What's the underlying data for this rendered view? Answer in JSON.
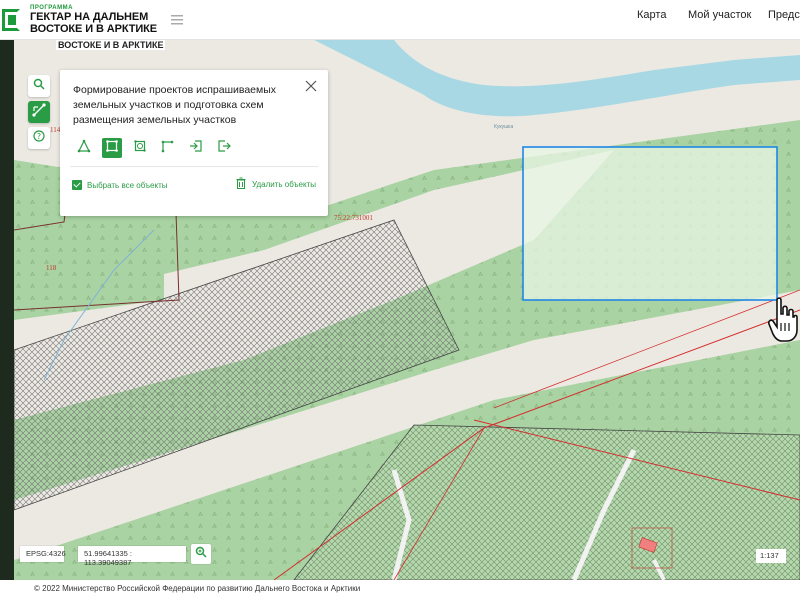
{
  "header": {
    "logo_small": "ПРОГРАММА",
    "logo_line1": "ГЕКТАР НА ДАЛЬНЕМ",
    "logo_line2": "ВОСТОКЕ И В АРКТИКЕ",
    "nav": [
      {
        "label": "Карта"
      },
      {
        "label": "Мой участок"
      },
      {
        "label": "Предст"
      }
    ]
  },
  "map": {
    "watermark_title": "ВОСТОКЕ И В АРКТИКЕ",
    "cadastral_label": "75:22:731001",
    "parcel_label": "118",
    "parcel_label_partial": "114",
    "river_label": "Кукушка"
  },
  "toolbar": {
    "buttons": [
      {
        "icon": "search-icon"
      },
      {
        "icon": "edit-geometry-icon",
        "active": true
      },
      {
        "icon": "help-icon"
      }
    ]
  },
  "panel": {
    "title": "Формирование проектов испрашиваемых земельных участков и подготовка схем размещения земельных участков",
    "tools": [
      {
        "icon": "polygon-icon"
      },
      {
        "icon": "rectangle-icon",
        "active": true
      },
      {
        "icon": "circle-select-icon"
      },
      {
        "icon": "line-icon"
      },
      {
        "icon": "import-icon"
      },
      {
        "icon": "export-icon"
      }
    ],
    "select_all_label": "Выбрать все объекты",
    "select_all_checked": true,
    "delete_label": "Удалить объекты"
  },
  "status": {
    "epsg": "EPSG:4326",
    "coordinates": "51.99641335 : 113.39049387",
    "scale": "1:137"
  },
  "footer": {
    "copyright": "© 2022 Министерство Российской Федерации по развитию Дальнего Востока и Арктики"
  },
  "colors": {
    "accent": "#2a9c45",
    "forest": "#a9d3a2",
    "land": "#ece9e3",
    "water": "#a8d8e3",
    "boundary": "#d32f2f",
    "selection": "#1e88e5"
  }
}
